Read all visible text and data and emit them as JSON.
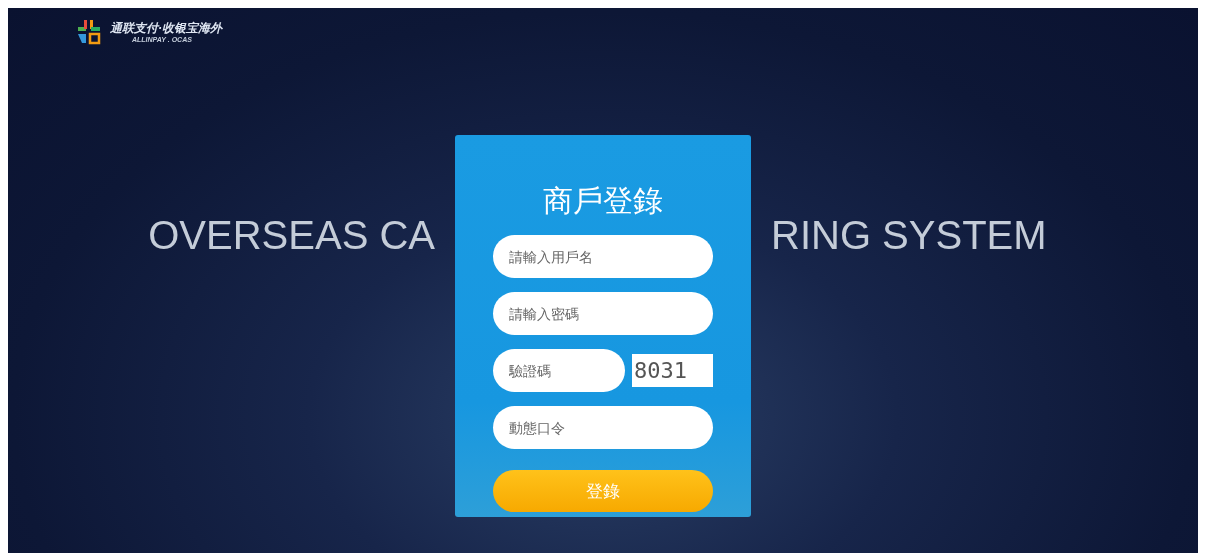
{
  "logo": {
    "title": "通联支付·收银宝海外",
    "subtitle": "ALLINPAY . OCAS"
  },
  "headline": {
    "left": "OVERSEAS CA",
    "right": "RING SYSTEM"
  },
  "login": {
    "title": "商戶登錄",
    "fields": [
      {
        "kind": "text",
        "placeholder": "請輸入用戶名"
      },
      {
        "kind": "password",
        "placeholder": "請輸入密碼"
      },
      {
        "kind": "captcha",
        "placeholder": "驗證碼",
        "code": "8031"
      },
      {
        "kind": "text",
        "placeholder": "動態口令"
      }
    ],
    "button": "登錄"
  }
}
